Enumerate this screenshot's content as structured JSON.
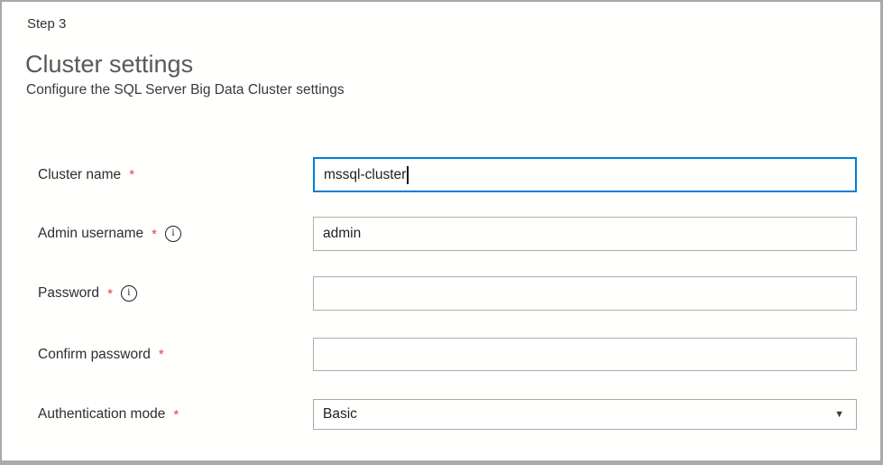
{
  "step": {
    "label": "Step 3"
  },
  "header": {
    "title": "Cluster settings",
    "subtitle": "Configure the SQL Server Big Data Cluster settings"
  },
  "form": {
    "fields": [
      {
        "label": "Cluster name",
        "required_marker": "*",
        "value": "mssql-cluster",
        "state": "focused"
      },
      {
        "label": "Admin username",
        "required_marker": "*",
        "value": "admin",
        "state": "normal"
      },
      {
        "label": "Password",
        "required_marker": "*",
        "value": "",
        "state": "normal"
      },
      {
        "label": "Confirm password",
        "required_marker": "*",
        "value": "",
        "state": "normal"
      },
      {
        "label": "Authentication mode",
        "required_marker": "*",
        "value": "Basic",
        "state": "normal"
      }
    ]
  },
  "icons": {
    "info": "i",
    "dropdown_arrow": "▼"
  },
  "colors": {
    "focus_border": "#007fd4",
    "required_asterisk": "#e04343",
    "dialog_border": "#a9a9a9",
    "input_border": "#aeaeae"
  }
}
